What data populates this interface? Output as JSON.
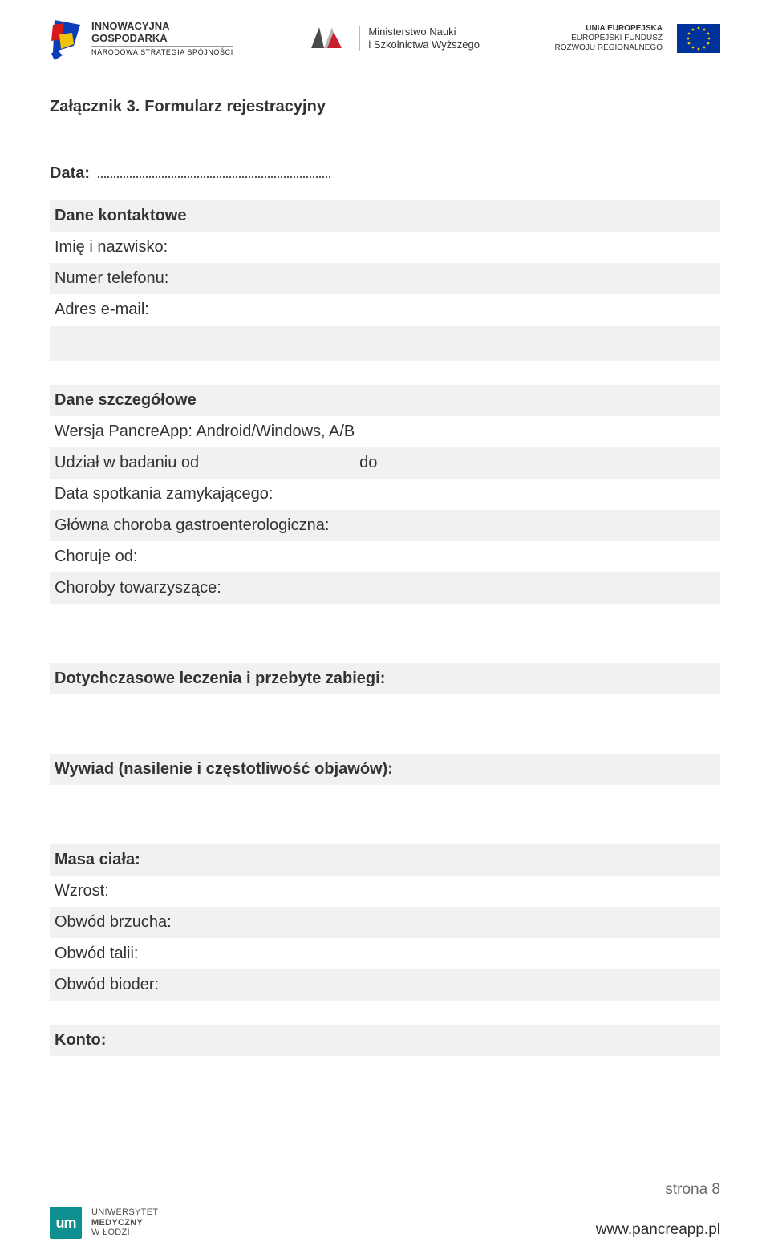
{
  "header": {
    "ig_line1": "INNOWACYJNA",
    "ig_line2": "GOSPODARKA",
    "ig_sub": "NARODOWA STRATEGIA SPÓJNOŚCI",
    "mnisw_line1": "Ministerstwo Nauki",
    "mnisw_line2": "i Szkolnictwa Wyższego",
    "eu_line1": "UNIA EUROPEJSKA",
    "eu_line2": "EUROPEJSKI FUNDUSZ",
    "eu_line3": "ROZWOJU REGIONALNEGO"
  },
  "title": {
    "prefix": "Załącznik 3.",
    "name": "Formularz rejestracyjny"
  },
  "data_label": "Data:",
  "contact": {
    "header": "Dane kontaktowe",
    "name": "Imię i nazwisko:",
    "phone": "Numer telefonu:",
    "email": "Adres e-mail:"
  },
  "details": {
    "header": "Dane szczegółowe",
    "version": "Wersja PancreApp: Android/Windows, A/B",
    "study_from": "Udział w badaniu od",
    "study_to": "do",
    "closing_meeting": "Data spotkania zamykającego:",
    "main_disease": "Główna choroba gastroenterologiczna:",
    "sick_since": "Choruje od:",
    "comorbid": "Choroby towarzyszące:"
  },
  "treatments_header": "Dotychczasowe leczenia i przebyte zabiegi:",
  "interview_header": "Wywiad (nasilenie i częstotliwość objawów):",
  "anthro": {
    "mass": "Masa ciała:",
    "height": "Wzrost:",
    "belly": "Obwód brzucha:",
    "waist": "Obwód talii:",
    "hips": "Obwód bioder:"
  },
  "account_header": "Konto:",
  "footer": {
    "um_line1": "UNIWERSYTET",
    "um_line2": "MEDYCZNY",
    "um_line3": "W ŁODZI",
    "page_label": "strona 8",
    "url": "www.pancreapp.pl"
  }
}
